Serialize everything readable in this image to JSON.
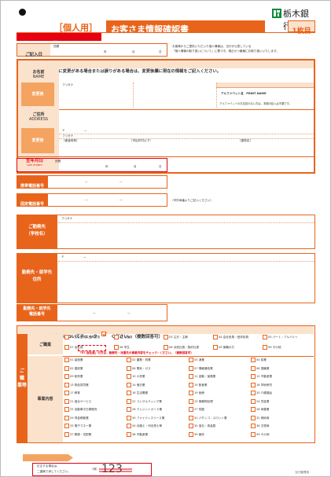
{
  "header": {
    "bank_name": "栃木銀行",
    "form_type": "［個人用］",
    "title": "お客さま情報確認書",
    "page_label": "1枚目",
    "notice": "※ボールペンでご記入ください。"
  },
  "date_filled": {
    "label": "ご記入日",
    "era": "西暦",
    "year": "年",
    "month": "月",
    "day": "日",
    "note1": "お客様からご提供いただいた個人情報は、当行が公表している",
    "note2": "「個人情報の取り扱いについて」に基づき、適正かつ厳格にお取り扱いいたします。"
  },
  "main": {
    "instruction": "印字されている内容に変更がある場合または誤りがある場合は、変更後欄に現在の情報をご記入ください。",
    "name_label": "お名前",
    "name_label_en": "NAME",
    "change_label": "変更後",
    "furigana": "フリガナ",
    "alphabet_header": "アルファベット名　PRINT NAME",
    "alphabet_note": "アルファベットのお名前のない方は、本欄の記入は不要です。",
    "address_label": "ご住所",
    "address_label_en": "ADDRESS",
    "postal_mark": "〒",
    "postal_dash": "―",
    "prefecture": "［都道府県］",
    "city": "［市区町村以下］",
    "building": "［建物名］",
    "birthday_label": "生年月日",
    "birthday_sub": "DATE OF BIRTH"
  },
  "contact": {
    "mobile_label": "携帯電話番号",
    "landline_label": "固定電話番号",
    "dash": "―",
    "landline_note": "（市外局番よりご記入ください）"
  },
  "work": {
    "label": "ご勤務先",
    "label_sub": "（学校名）",
    "address_label": "勤務先・就学先",
    "address_label2": "住所",
    "phone_label": "勤務先・就学先",
    "phone_label2": "電話番号"
  },
  "occupation": {
    "header_a": "ご職業等についてチェック",
    "header_b": "ください。（複数回答可）",
    "side1": "ご",
    "side2": "職",
    "side3": "業等",
    "label": "ご職業",
    "business_label": "事業内容",
    "student_note": "「07.会社員」の方は、勤務先・派遣先の事業内容をチェック✓ください。（複数回答可）",
    "occupations": [
      "01 会社役員・団体役員",
      "02 公務員",
      "03 主夫・主婦",
      "04 会社役員・団体役員",
      "05 パート・アルバイト",
      "07 会社員",
      "06 学生",
      "08 派遣社員・契約社員",
      "09 無職の方",
      "99 その他"
    ],
    "businesses": [
      "01 製造業",
      "02 農業・林業",
      "03 漁業",
      "04 鉱業",
      "05 建設業",
      "06 電気・ガス",
      "07 情報通信業",
      "08 運輸業",
      "09 卸売業",
      "10 小売業",
      "11 金融・保険業",
      "12 不動産業",
      "13 物品賃貸業",
      "14 宿泊業",
      "15 飲食業",
      "16 学術研究",
      "17 教育",
      "18 生活関連",
      "19 医療",
      "20 介護福祉",
      "21 複合サービス",
      "22 コンサルティング業",
      "23 廃棄物処理",
      "24 貸金業",
      "25 自動車中古車販売",
      "26 クレジットカード業",
      "27 質屋",
      "28 両替業",
      "29 資金移動業",
      "30 ファイナンスリース業",
      "31 パチンコ・スロット業",
      "32 美術商",
      "33 電子マネー業",
      "34 弁護士・司法書士等",
      "35 宝石・貴金属",
      "36 古物商",
      "37 郵便・宅配業",
      "38 不動産業",
      "39 競売",
      "99 その他"
    ]
  },
  "footer": {
    "next_page": "次ページへ続く",
    "correction_1": "訂正する場合は、",
    "correction_2": "二重線で消してください。",
    "example_label": "（例）",
    "example_value": "123",
    "internal_use": "当行管理用"
  }
}
